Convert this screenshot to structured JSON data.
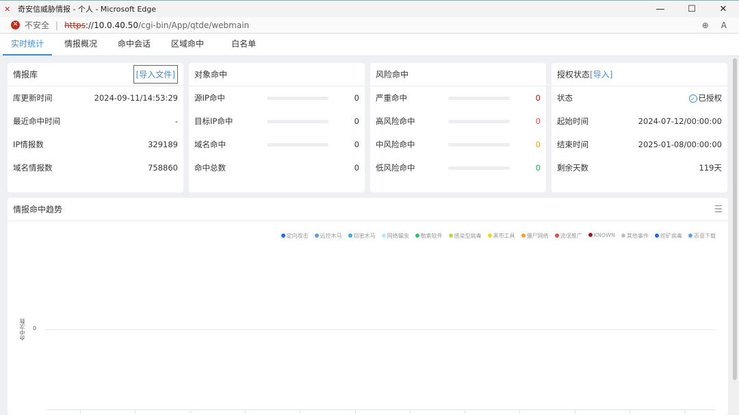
{
  "window": {
    "title": "奇安信威胁情报 - 个人 - Microsoft Edge",
    "minimize": "—",
    "maximize": "☐",
    "close": "✕"
  },
  "address": {
    "security": "不安全",
    "scheme": "https",
    "host": "://10.0.40.50",
    "path": "/cgi-bin/App/qtde/webmain"
  },
  "tabs": [
    {
      "label": "实时统计",
      "active": true
    },
    {
      "label": "情报概况"
    },
    {
      "label": "命中会话"
    },
    {
      "label": "区域命中"
    },
    {
      "label": "白名单"
    }
  ],
  "cards": {
    "intel": {
      "title": "情报库",
      "import_label": "[导入文件]",
      "rows": [
        {
          "label": "库更新时间",
          "value": "2024-09-11/14:53:29"
        },
        {
          "label": "最近命中时间",
          "value": "-"
        },
        {
          "label": "IP情报数",
          "value": "329189"
        },
        {
          "label": "域名情报数",
          "value": "758860"
        }
      ]
    },
    "object": {
      "title": "对象命中",
      "rows": [
        {
          "label": "源IP命中",
          "value": "0"
        },
        {
          "label": "目标IP命中",
          "value": "0"
        },
        {
          "label": "域名命中",
          "value": "0"
        },
        {
          "label": "命中总数",
          "value": "0"
        }
      ]
    },
    "risk": {
      "title": "风险命中",
      "rows": [
        {
          "label": "严重命中",
          "value": "0",
          "color": "#a01818"
        },
        {
          "label": "高风险命中",
          "value": "0",
          "color": "#f04848"
        },
        {
          "label": "中风险命中",
          "value": "0",
          "color": "#f5a023"
        },
        {
          "label": "低风险命中",
          "value": "0",
          "color": "#2da84a"
        }
      ]
    },
    "license": {
      "title": "授权状态",
      "import_label": "[导入]",
      "status_label": "状态",
      "status_value": "已授权",
      "rows": [
        {
          "label": "起始时间",
          "value": "2024-07-12/00:00:00"
        },
        {
          "label": "结束时间",
          "value": "2025-01-08/00:00:00"
        },
        {
          "label": "剩余天数",
          "value": "119天"
        }
      ]
    }
  },
  "trend": {
    "title": "情报命中趋势"
  },
  "chart_data": {
    "type": "line",
    "ylabel": "命中次数",
    "yticks": [
      "0"
    ],
    "series": [
      {
        "name": "定向攻击",
        "color": "#1a6cf0"
      },
      {
        "name": "远控木马",
        "color": "#5b9bf0"
      },
      {
        "name": "窃密木马",
        "color": "#39a8f0"
      },
      {
        "name": "网络蠕虫",
        "color": "#a7f0f7"
      },
      {
        "name": "勒索软件",
        "color": "#2dc46a"
      },
      {
        "name": "感染型病毒",
        "color": "#b9d940"
      },
      {
        "name": "黑市工具",
        "color": "#f5d21c"
      },
      {
        "name": "僵尸网络",
        "color": "#f5a023"
      },
      {
        "name": "流氓推广",
        "color": "#f04848"
      },
      {
        "name": "KNOWN",
        "color": "#a01818"
      },
      {
        "name": "其他事件",
        "color": "#c0c0c0"
      },
      {
        "name": "挖矿病毒",
        "color": "#1a6cf0"
      },
      {
        "name": "恶意下载",
        "color": "#5ba0f0"
      }
    ]
  }
}
